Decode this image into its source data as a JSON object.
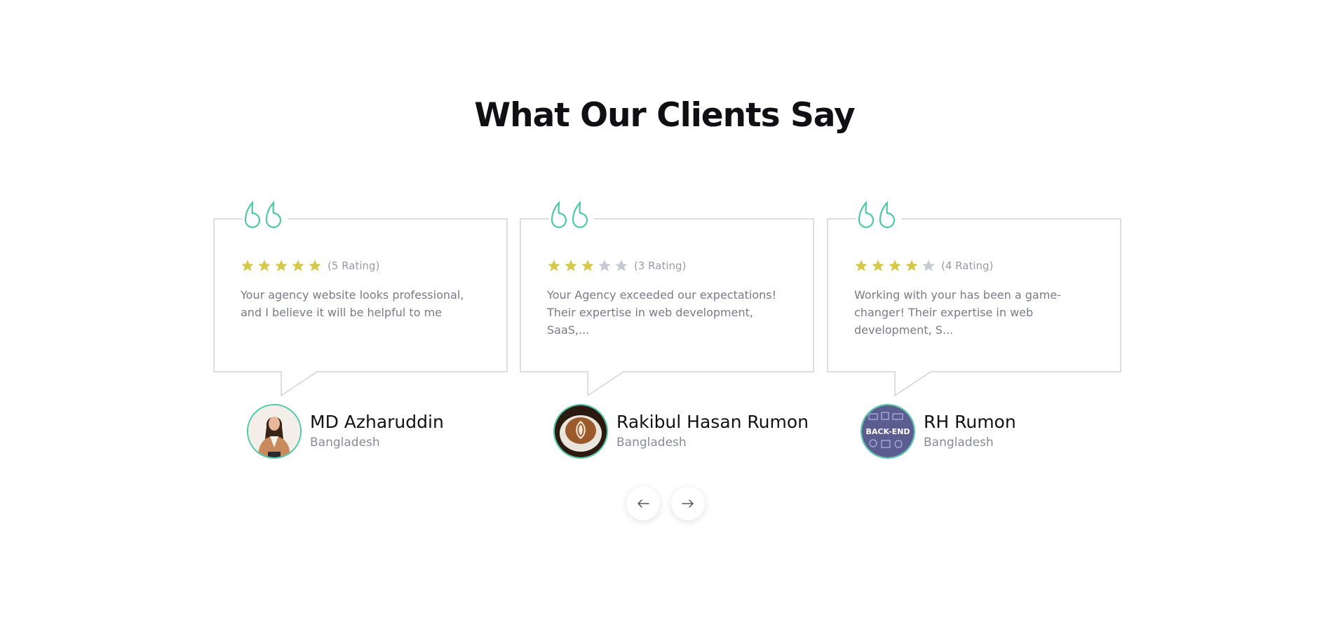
{
  "section": {
    "title": "What Our Clients Say"
  },
  "colors": {
    "accent": "#4fc9a4",
    "star_filled": "#d4c94a",
    "star_empty": "#c5cad3",
    "card_border": "#d3d3d8"
  },
  "testimonials": [
    {
      "rating": 5,
      "rating_label": "(5 Rating)",
      "review": "Your agency website looks professional, and I believe it will be helpful to me",
      "name": "MD Azharuddin",
      "country": "Bangladesh",
      "avatar_icon": "woman-portrait-avatar"
    },
    {
      "rating": 3,
      "rating_label": "(3 Rating)",
      "review": "Your Agency exceeded our expectations! Their expertise in web development, SaaS,...",
      "name": "Rakibul Hasan Rumon",
      "country": "Bangladesh",
      "avatar_icon": "coffee-latte-avatar"
    },
    {
      "rating": 4,
      "rating_label": "(4 Rating)",
      "review": "Working with your has been a game-changer! Their expertise in web development, S...",
      "name": "RH Rumon",
      "country": "Bangladesh",
      "avatar_icon": "backend-badge-avatar",
      "avatar_text": "BACK-END"
    }
  ],
  "navigation": {
    "prev_icon": "arrow-left-icon",
    "next_icon": "arrow-right-icon"
  }
}
